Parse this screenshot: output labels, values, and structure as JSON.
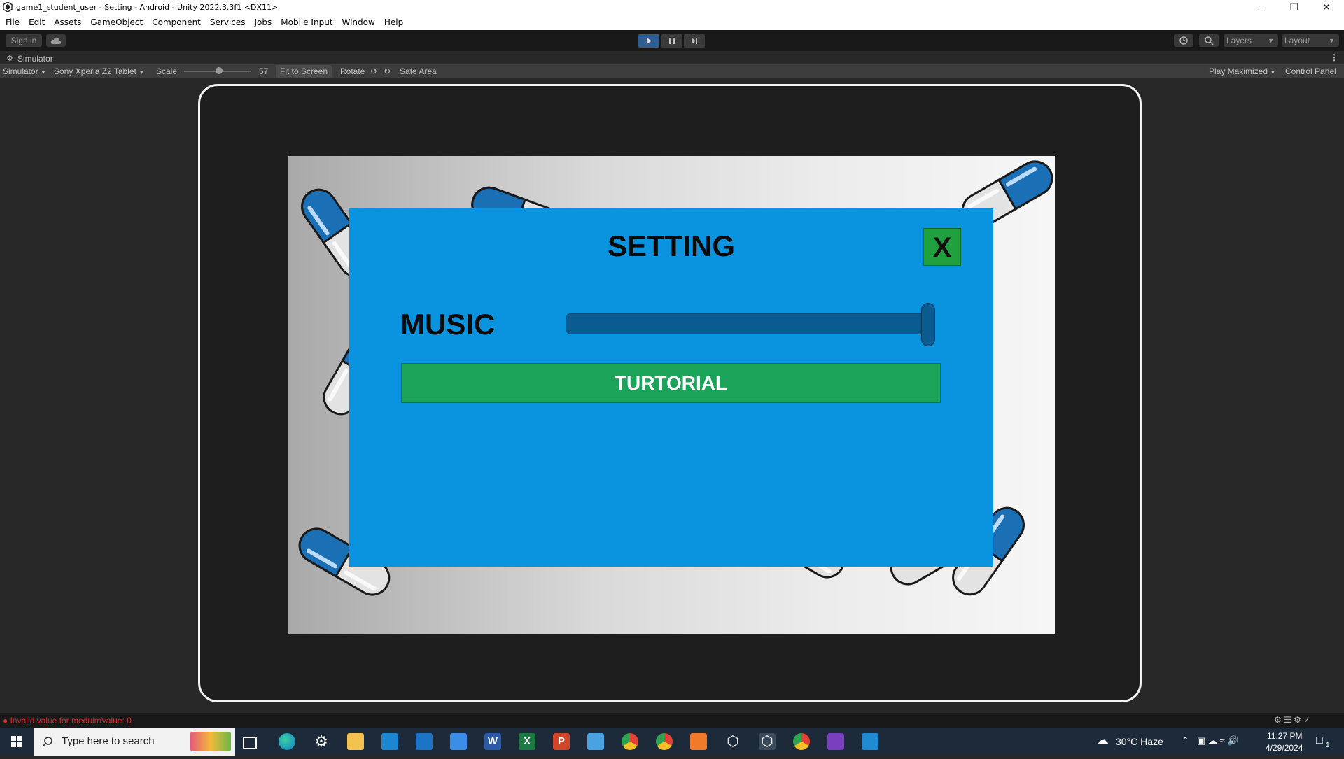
{
  "window": {
    "title": "game1_student_user - Setting - Android - Unity 2022.3.3f1 <DX11>",
    "minimize_glyph": "–",
    "restore_glyph": "❐",
    "close_glyph": "✕"
  },
  "menu": [
    "File",
    "Edit",
    "Assets",
    "GameObject",
    "Component",
    "Services",
    "Jobs",
    "Mobile Input",
    "Window",
    "Help"
  ],
  "toolbar": {
    "sign_in": "Sign in",
    "layers": "Layers",
    "layout": "Layout"
  },
  "simulator_tab": {
    "label": "Simulator"
  },
  "simulator_bar": {
    "mode": "Simulator",
    "device": "Sony Xperia Z2 Tablet",
    "scale_label": "Scale",
    "scale_value": "57",
    "fit_to_screen": "Fit to Screen",
    "rotate": "Rotate",
    "safe_area": "Safe Area",
    "play_maximized": "Play Maximized",
    "control_panel": "Control Panel"
  },
  "game": {
    "title": "SETTING",
    "close_label": "X",
    "music_label": "MUSIC",
    "music_volume": 1.0,
    "tutorial_label": "TURTORIAL"
  },
  "status": {
    "error": "Invalid value for meduimValue: 0"
  },
  "taskbar": {
    "search_placeholder": "Type here to search",
    "weather": "30°C  Haze",
    "time": "11:27 PM",
    "date": "4/29/2024",
    "notification_count": "1"
  },
  "colors": {
    "panel": "#0a93de",
    "close_button": "#21a03f",
    "tutorial_button": "#1ba359",
    "slider": "#0a5b8f",
    "pill_blue": "#1a6fb5",
    "pill_white": "#e6e6e6"
  }
}
